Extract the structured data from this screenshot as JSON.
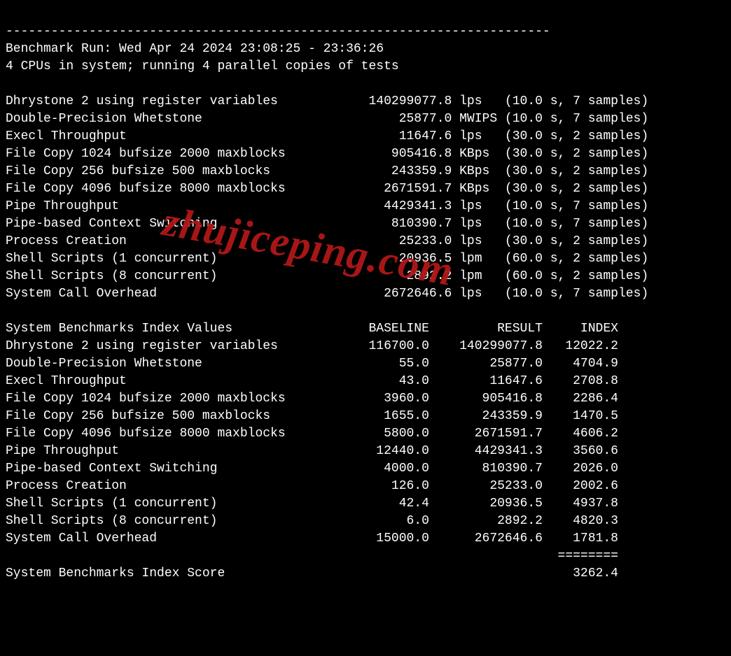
{
  "separator": "------------------------------------------------------------------------",
  "header": {
    "run_line": "Benchmark Run: Wed Apr 24 2024 23:08:25 - 23:36:26",
    "cpu_line": "4 CPUs in system; running 4 parallel copies of tests"
  },
  "tests": [
    {
      "name": "Dhrystone 2 using register variables",
      "value": "140299077.8",
      "unit": "lps",
      "dur": "10.0",
      "samples": "7"
    },
    {
      "name": "Double-Precision Whetstone",
      "value": "25877.0",
      "unit": "MWIPS",
      "dur": "10.0",
      "samples": "7"
    },
    {
      "name": "Execl Throughput",
      "value": "11647.6",
      "unit": "lps",
      "dur": "30.0",
      "samples": "2"
    },
    {
      "name": "File Copy 1024 bufsize 2000 maxblocks",
      "value": "905416.8",
      "unit": "KBps",
      "dur": "30.0",
      "samples": "2"
    },
    {
      "name": "File Copy 256 bufsize 500 maxblocks",
      "value": "243359.9",
      "unit": "KBps",
      "dur": "30.0",
      "samples": "2"
    },
    {
      "name": "File Copy 4096 bufsize 8000 maxblocks",
      "value": "2671591.7",
      "unit": "KBps",
      "dur": "30.0",
      "samples": "2"
    },
    {
      "name": "Pipe Throughput",
      "value": "4429341.3",
      "unit": "lps",
      "dur": "10.0",
      "samples": "7"
    },
    {
      "name": "Pipe-based Context Switching",
      "value": "810390.7",
      "unit": "lps",
      "dur": "10.0",
      "samples": "7"
    },
    {
      "name": "Process Creation",
      "value": "25233.0",
      "unit": "lps",
      "dur": "30.0",
      "samples": "2"
    },
    {
      "name": "Shell Scripts (1 concurrent)",
      "value": "20936.5",
      "unit": "lpm",
      "dur": "60.0",
      "samples": "2"
    },
    {
      "name": "Shell Scripts (8 concurrent)",
      "value": "2892.2",
      "unit": "lpm",
      "dur": "60.0",
      "samples": "2"
    },
    {
      "name": "System Call Overhead",
      "value": "2672646.6",
      "unit": "lps",
      "dur": "10.0",
      "samples": "7"
    }
  ],
  "index_header": {
    "label": "System Benchmarks Index Values",
    "col_baseline": "BASELINE",
    "col_result": "RESULT",
    "col_index": "INDEX"
  },
  "index_rows": [
    {
      "name": "Dhrystone 2 using register variables",
      "baseline": "116700.0",
      "result": "140299077.8",
      "index": "12022.2"
    },
    {
      "name": "Double-Precision Whetstone",
      "baseline": "55.0",
      "result": "25877.0",
      "index": "4704.9"
    },
    {
      "name": "Execl Throughput",
      "baseline": "43.0",
      "result": "11647.6",
      "index": "2708.8"
    },
    {
      "name": "File Copy 1024 bufsize 2000 maxblocks",
      "baseline": "3960.0",
      "result": "905416.8",
      "index": "2286.4"
    },
    {
      "name": "File Copy 256 bufsize 500 maxblocks",
      "baseline": "1655.0",
      "result": "243359.9",
      "index": "1470.5"
    },
    {
      "name": "File Copy 4096 bufsize 8000 maxblocks",
      "baseline": "5800.0",
      "result": "2671591.7",
      "index": "4606.2"
    },
    {
      "name": "Pipe Throughput",
      "baseline": "12440.0",
      "result": "4429341.3",
      "index": "3560.6"
    },
    {
      "name": "Pipe-based Context Switching",
      "baseline": "4000.0",
      "result": "810390.7",
      "index": "2026.0"
    },
    {
      "name": "Process Creation",
      "baseline": "126.0",
      "result": "25233.0",
      "index": "2002.6"
    },
    {
      "name": "Shell Scripts (1 concurrent)",
      "baseline": "42.4",
      "result": "20936.5",
      "index": "4937.8"
    },
    {
      "name": "Shell Scripts (8 concurrent)",
      "baseline": "6.0",
      "result": "2892.2",
      "index": "4820.3"
    },
    {
      "name": "System Call Overhead",
      "baseline": "15000.0",
      "result": "2672646.6",
      "index": "1781.8"
    }
  ],
  "index_rule": "========",
  "score": {
    "label": "System Benchmarks Index Score",
    "value": "3262.4"
  },
  "watermark": "zhujiceping.com"
}
